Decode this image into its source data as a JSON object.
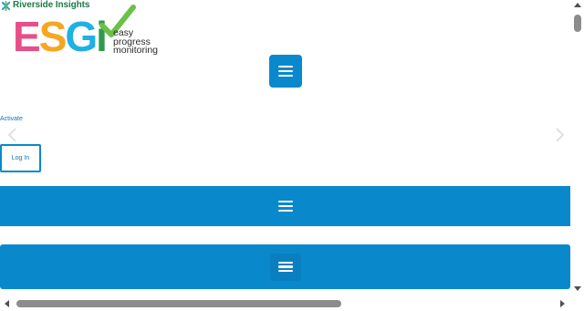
{
  "header": {
    "brand_parent": "Riverside Insights",
    "logo_letters": [
      "E",
      "S",
      "G",
      "i"
    ],
    "logo_colors": [
      "#e84e8a",
      "#f5a623",
      "#1fb0e6",
      "#2e9a4a"
    ],
    "tagline": [
      "easy",
      "progress",
      "monitoring"
    ]
  },
  "nav": {
    "toggle_icon": "hamburger-menu-icon"
  },
  "links": {
    "activate": "Activate",
    "login": "Log In"
  },
  "carousel": {
    "prev_icon": "chevron-left-icon",
    "next_icon": "chevron-right-icon"
  },
  "colors": {
    "accent": "#0a88cc",
    "link": "#0a78b8",
    "check_green": "#6cc04a"
  }
}
